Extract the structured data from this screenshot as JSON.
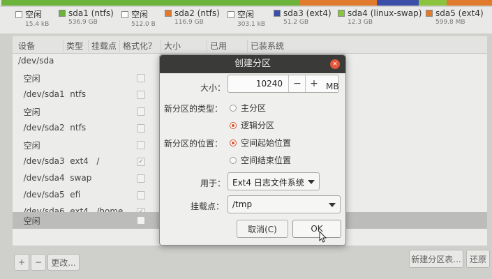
{
  "colors": {
    "free": "#e6e6e6",
    "ntfs": "#6cb33b",
    "ext4": "#3c4ea8",
    "swap": "#8ac43f",
    "efi": "#e07a2c",
    "accent": "#d4542f"
  },
  "legend": [
    {
      "name": "空闲",
      "size": "15.4 kB",
      "color": "#ffffff"
    },
    {
      "name": "sda1 (ntfs)",
      "size": "536.9 GB",
      "color": "#6cb33b"
    },
    {
      "name": "空闲",
      "size": "512.0 B",
      "color": "#ffffff"
    },
    {
      "name": "sda2 (ntfs)",
      "size": "116.9 GB",
      "color": "#e07a2c"
    },
    {
      "name": "空闲",
      "size": "303.1 kB",
      "color": "#ffffff"
    },
    {
      "name": "sda3 (ext4)",
      "size": "51.2 GB",
      "color": "#3c4ea8"
    },
    {
      "name": "sda4 (linux-swap)",
      "size": "12.3 GB",
      "color": "#8ac43f"
    },
    {
      "name": "sda5 (ext4)",
      "size": "599.8 MB",
      "color": "#e07a2c"
    }
  ],
  "table": {
    "headers": [
      "设备",
      "类型",
      "挂载点",
      "格式化？",
      "大小",
      "已用",
      "已装系统"
    ],
    "rows": [
      {
        "device": "/dev/sda",
        "checked": false
      },
      {
        "device": "  空闲",
        "checked": false
      },
      {
        "device": "  /dev/sda1  ntfs",
        "checked": false
      },
      {
        "device": "  空闲",
        "checked": false
      },
      {
        "device": "  /dev/sda2  ntfs",
        "checked": false
      },
      {
        "device": "  空闲",
        "checked": false
      },
      {
        "device": "  /dev/sda3  ext4   /",
        "checked": true
      },
      {
        "device": "  /dev/sda4  swap",
        "checked": false
      },
      {
        "device": "  /dev/sda5  efi",
        "checked": false
      },
      {
        "device": "  /dev/sda6  ext4   /home",
        "checked": true
      },
      {
        "device": "  空闲",
        "checked": false
      }
    ]
  },
  "toolbar": {
    "add": "+",
    "remove": "−",
    "change": "更改...",
    "new_table": "新建分区表...",
    "revert": "还原"
  },
  "dialog": {
    "title": "创建分区",
    "close": "×",
    "size_label": "大小：",
    "size_value": "10240",
    "minus": "−",
    "plus": "+",
    "unit": "MB",
    "type_label": "新分区的类型：",
    "type_primary": "主分区",
    "type_logical": "逻辑分区",
    "location_label": "新分区的位置：",
    "location_start": "空间起始位置",
    "location_end": "空间结束位置",
    "use_label": "用于：",
    "use_value": "Ext4 日志文件系统",
    "mount_label": "挂载点：",
    "mount_value": "/tmp",
    "cancel": "取消(C)",
    "ok": "OK"
  }
}
